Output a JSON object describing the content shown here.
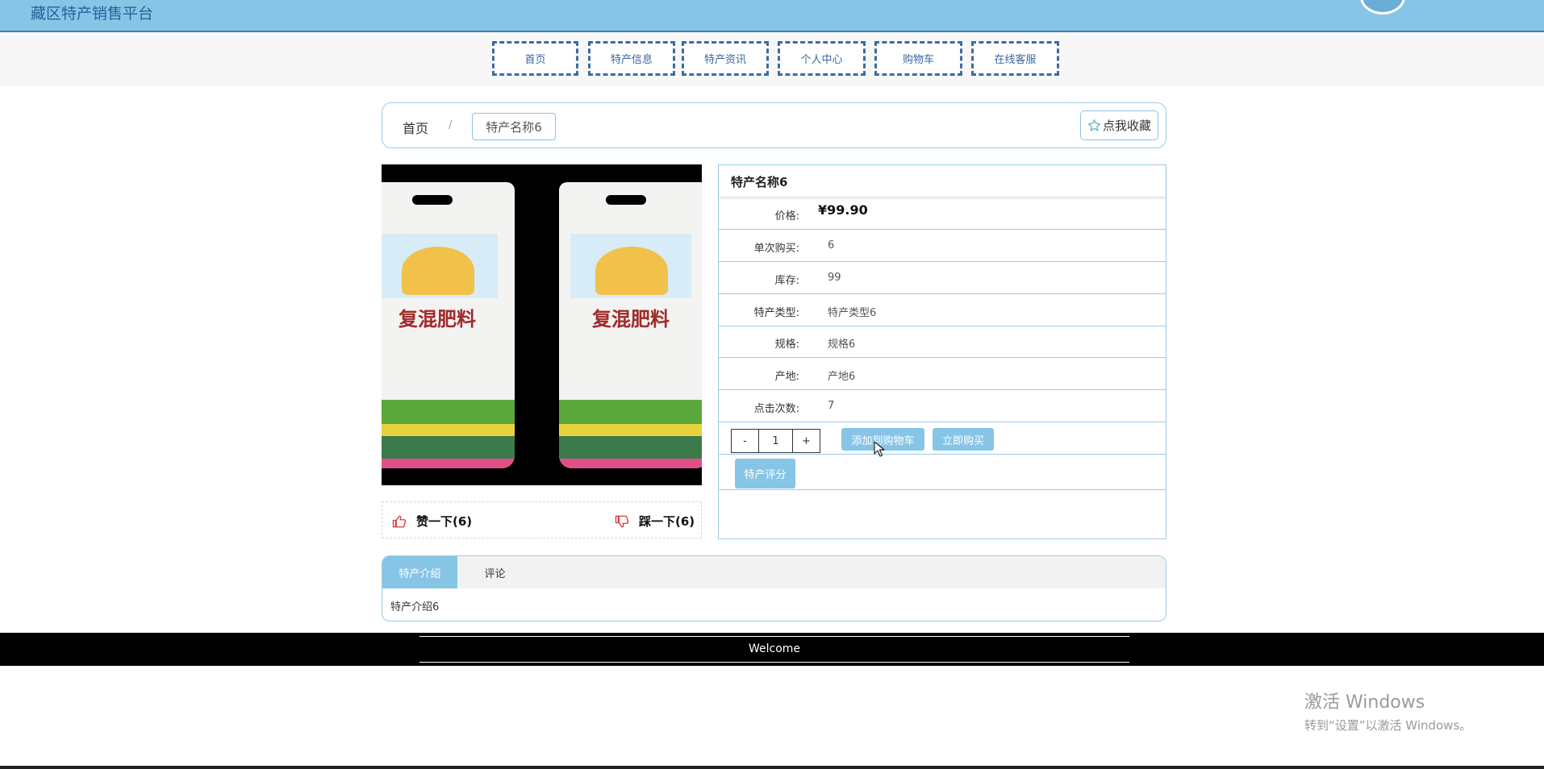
{
  "header": {
    "site_title": "藏区特产销售平台"
  },
  "nav": {
    "items": [
      {
        "label": "首页"
      },
      {
        "label": "特产信息"
      },
      {
        "label": "特产资讯"
      },
      {
        "label": "个人中心"
      },
      {
        "label": "购物车"
      },
      {
        "label": "在线客服"
      }
    ]
  },
  "breadcrumb": {
    "home": "首页",
    "separator": "/",
    "current": "特产名称6"
  },
  "favorite": {
    "label": "点我收藏",
    "icon": "star-icon"
  },
  "product_image": {
    "bag_title": "复混肥料"
  },
  "votes": {
    "like_label": "赞一下(6)",
    "dislike_label": "踩一下(6)"
  },
  "product": {
    "name": "特产名称6",
    "price_label": "价格:",
    "price": "¥99.90",
    "fields": [
      {
        "label": "单次购买:",
        "value": "6"
      },
      {
        "label": "库存:",
        "value": "99"
      },
      {
        "label": "特产类型:",
        "value": "特产类型6"
      },
      {
        "label": "规格:",
        "value": "规格6"
      },
      {
        "label": "产地:",
        "value": "产地6"
      },
      {
        "label": "点击次数:",
        "value": "7"
      }
    ]
  },
  "purchase": {
    "minus": "-",
    "quantity": "1",
    "plus": "+",
    "add_to_cart": "添加到购物车",
    "buy_now": "立即购买"
  },
  "review": {
    "label": "特产评分"
  },
  "tabs": {
    "intro": "特产介绍",
    "comments": "评论",
    "content": "特产介绍6"
  },
  "footer": {
    "text": "Welcome"
  },
  "watermark": {
    "line1": "激活 Windows",
    "line2": "转到“设置”以激活 Windows。"
  },
  "colors": {
    "accent": "#87c5e6",
    "nav_border": "#3f6aa0",
    "footer_bg": "#000000"
  }
}
